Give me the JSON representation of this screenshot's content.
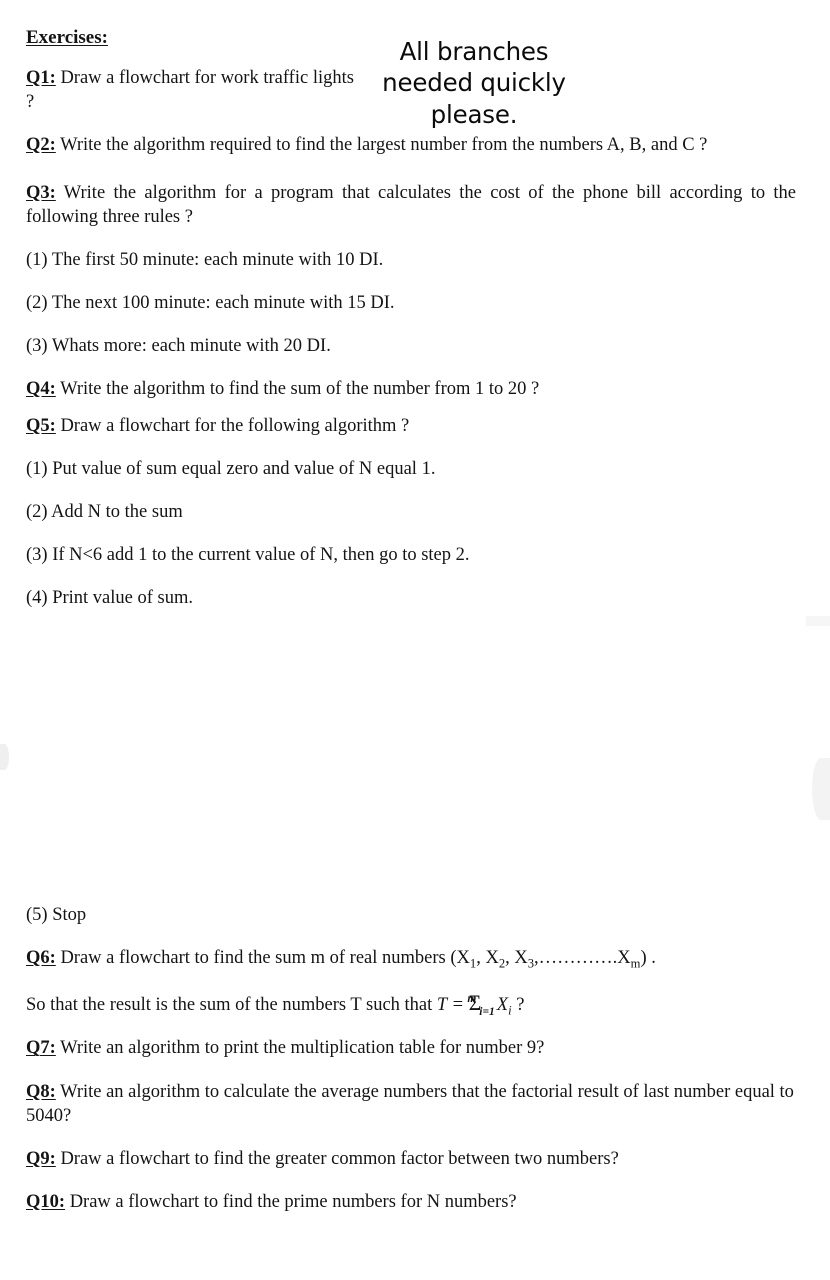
{
  "document": {
    "heading": "Exercises:",
    "annotation": {
      "lines": [
        "All branches",
        "needed quickly",
        "please."
      ]
    },
    "questions": [
      {
        "label": "Q1:",
        "text": " Draw a flowchart for work traffic lights ?"
      },
      {
        "label": "Q2:",
        "text": " Write the algorithm required to find the largest number from the numbers A, B, and C ?"
      },
      {
        "label": "Q3:",
        "text": " Write the algorithm for a program that calculates the cost of the phone bill according to the following three rules ?"
      }
    ],
    "phone_rules": [
      "(1) The first 50 minute: each minute with 10 DI.",
      "(2) The next 100 minute: each minute with 15 DI.",
      "(3) Whats more: each minute with 20 DI."
    ],
    "q4": {
      "label": "Q4:",
      "text": " Write the algorithm to find the sum of the number from 1 to 20 ?"
    },
    "q5": {
      "label": "Q5:",
      "text": " Draw a flowchart for the following algorithm ?"
    },
    "q5_steps": [
      "(1) Put value of sum equal zero and value of N equal 1.",
      "(2) Add N to the sum",
      "(3) If N<6 add 1 to the current value of  N, then go to step 2.",
      "(4) Print value of sum.",
      "(5) Stop"
    ],
    "q6": {
      "label": "Q6:",
      "text_before": " Draw a flowchart to find the sum m of real numbers (X",
      "sub1": "1",
      "mid1": ", X",
      "sub2": "2",
      "mid2": ", X",
      "sub3": "3",
      "mid3": ",………….X",
      "sub4": "m",
      "text_after": ") .",
      "line2_before": "So that the result is the sum of the numbers T such that ",
      "formula_t": "T",
      "formula_eq": " = ",
      "formula_sigma": "Σ",
      "formula_lower": "i=1",
      "formula_upper": "m",
      "formula_x": "X",
      "formula_x_sub": "i",
      "line2_after": " ?"
    },
    "q7": {
      "label": "Q7:",
      "text": " Write an algorithm to print the multiplication table for number 9?"
    },
    "q8": {
      "label": "Q8:",
      "text": " Write an algorithm to calculate the average numbers that the factorial result of  last number equal to 5040?"
    },
    "q9": {
      "label": "Q9:",
      "text": " Draw a flowchart to find the greater common factor between two numbers?"
    },
    "q10": {
      "label": "Q10:",
      "text": " Draw a flowchart to find the  prime numbers for N numbers?"
    }
  }
}
